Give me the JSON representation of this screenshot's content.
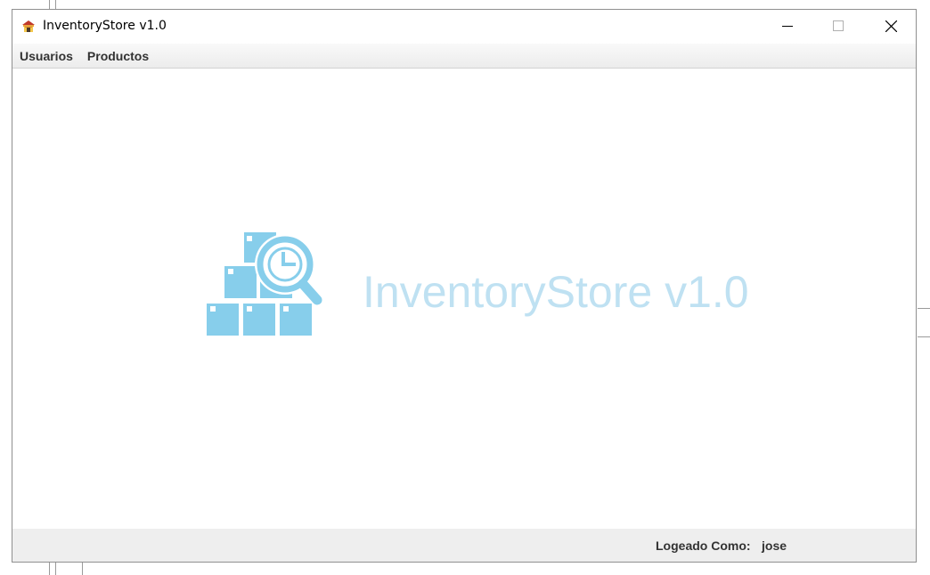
{
  "window": {
    "title": "InventoryStore v1.0"
  },
  "menubar": {
    "items": [
      {
        "label": "Usuarios"
      },
      {
        "label": "Productos"
      }
    ]
  },
  "content": {
    "logo_text": "InventoryStore v1.0",
    "logo_icon": "boxes-magnifier-icon"
  },
  "statusbar": {
    "logged_label": "Logeado Como:",
    "user": "jose"
  },
  "colors": {
    "logo_blue": "#87ceeb",
    "logo_text": "#bfe1f2",
    "menubar_bg": "#ececec",
    "statusbar_bg": "#eeeeee"
  }
}
